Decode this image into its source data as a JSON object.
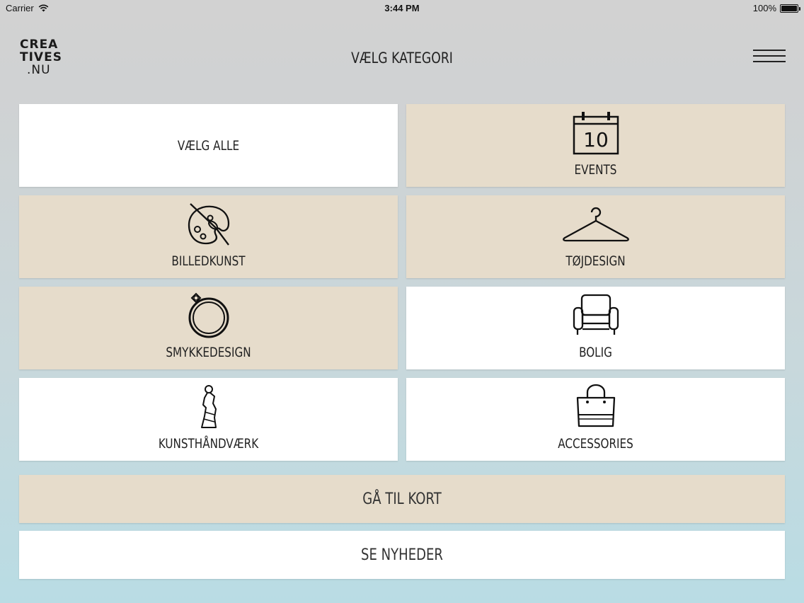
{
  "status_bar": {
    "carrier": "Carrier",
    "time": "3:44 PM",
    "battery": "100%"
  },
  "header": {
    "logo_line1": "CREA",
    "logo_line2": "TIVES",
    "logo_line3": ".NU",
    "title": "VÆLG KATEGORI"
  },
  "tiles": [
    {
      "label": "VÆLG ALLE",
      "icon": "none",
      "color": "#ffffff"
    },
    {
      "label": "EVENTS",
      "icon": "calendar-icon",
      "calendar_day": "10",
      "color": "#e6dccb"
    },
    {
      "label": "BILLEDKUNST",
      "icon": "palette-icon",
      "color": "#e6dccb"
    },
    {
      "label": "TØJDESIGN",
      "icon": "hanger-icon",
      "color": "#e6dccb"
    },
    {
      "label": "SMYKKEDESIGN",
      "icon": "ring-icon",
      "color": "#e6dccb"
    },
    {
      "label": "BOLIG",
      "icon": "armchair-icon",
      "color": "#ffffff"
    },
    {
      "label": "KUNSTHÅNDVÆRK",
      "icon": "statue-icon",
      "color": "#ffffff"
    },
    {
      "label": "ACCESSORIES",
      "icon": "handbag-icon",
      "color": "#ffffff"
    }
  ],
  "actions": {
    "map_label": "GÅ TIL KORT",
    "news_label": "SE NYHEDER"
  }
}
